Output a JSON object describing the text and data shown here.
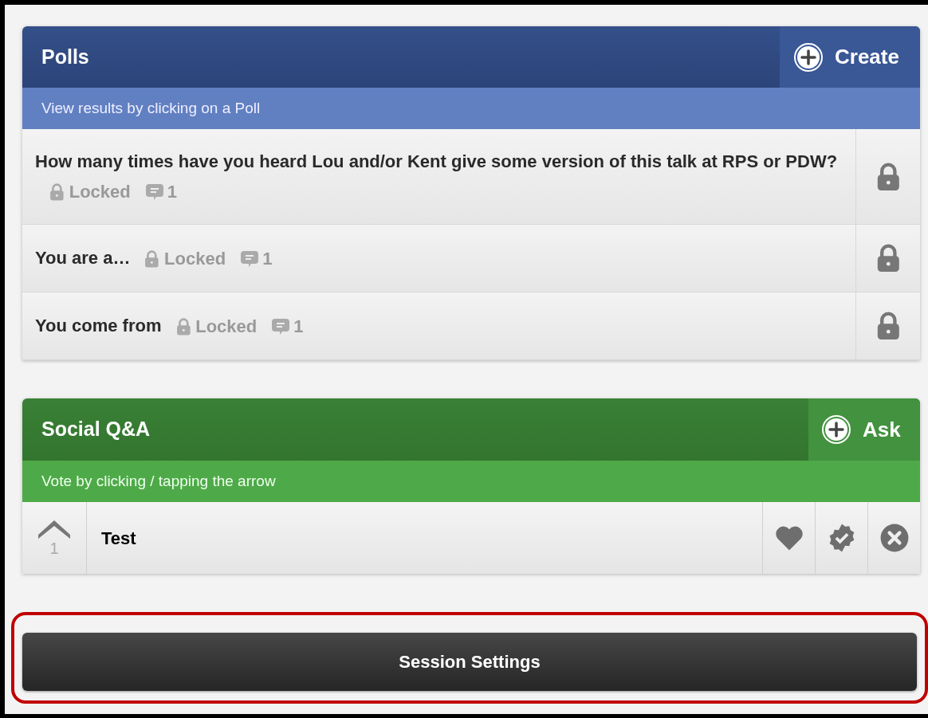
{
  "polls": {
    "title": "Polls",
    "create_label": "Create",
    "subtitle": "View results by clicking on a Poll",
    "items": [
      {
        "question": "How many times have you heard Lou and/or Kent give some version of this talk at RPS or PDW?",
        "status": "Locked",
        "comments": "1"
      },
      {
        "question": "You are a…",
        "status": "Locked",
        "comments": "1"
      },
      {
        "question": "You come from",
        "status": "Locked",
        "comments": "1"
      }
    ]
  },
  "social_qa": {
    "title": "Social Q&A",
    "ask_label": "Ask",
    "subtitle": "Vote by clicking / tapping the arrow",
    "items": [
      {
        "votes": "1",
        "text": "Test"
      }
    ]
  },
  "session_settings": {
    "label": "Session Settings"
  }
}
